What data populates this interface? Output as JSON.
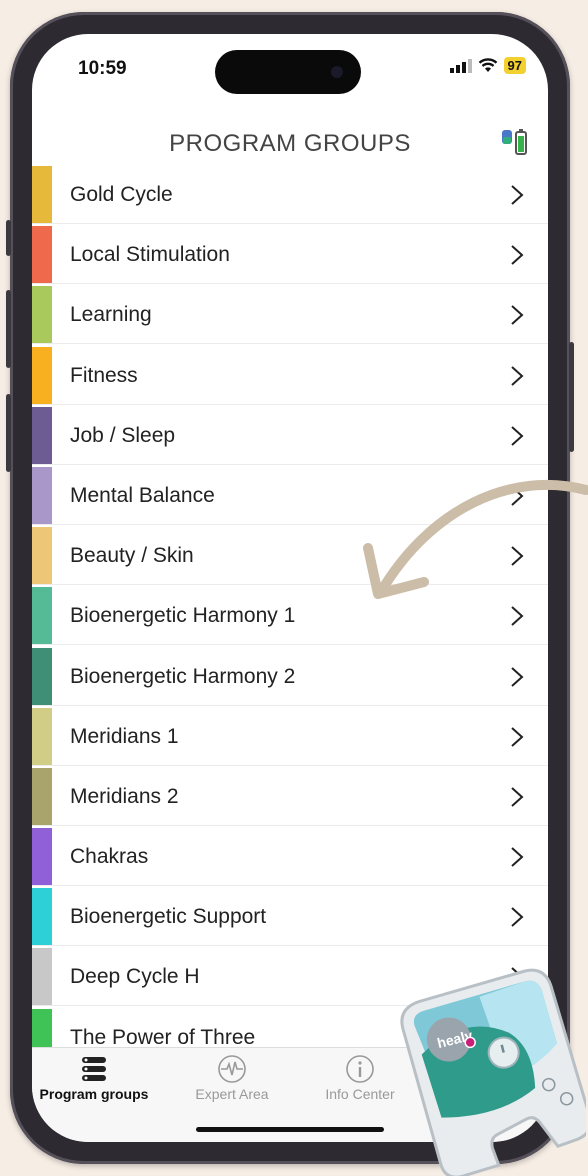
{
  "status_bar": {
    "time": "10:59",
    "battery": "97"
  },
  "header": {
    "title": "PROGRAM GROUPS"
  },
  "groups": [
    {
      "label": "Gold Cycle",
      "color": "#e6b93a"
    },
    {
      "label": "Local Stimulation",
      "color": "#ef6a4c"
    },
    {
      "label": "Learning",
      "color": "#a9c95d"
    },
    {
      "label": "Fitness",
      "color": "#f8b020"
    },
    {
      "label": "Job / Sleep",
      "color": "#6d5b93"
    },
    {
      "label": "Mental Balance",
      "color": "#a897c8"
    },
    {
      "label": "Beauty / Skin",
      "color": "#eec678"
    },
    {
      "label": "Bioenergetic Harmony 1",
      "color": "#55bb97"
    },
    {
      "label": "Bioenergetic Harmony 2",
      "color": "#3e8f75"
    },
    {
      "label": "Meridians 1",
      "color": "#d2cd86"
    },
    {
      "label": "Meridians 2",
      "color": "#a9a46b"
    },
    {
      "label": "Chakras",
      "color": "#9060d8"
    },
    {
      "label": "Bioenergetic Support",
      "color": "#2cd0d6"
    },
    {
      "label": "Deep Cycle H",
      "color": "#c8c8c8"
    },
    {
      "label": "The Power of Three",
      "color": "#3fc256"
    }
  ],
  "tabs": [
    {
      "label": "Program groups",
      "active": true,
      "icon": "list-icon"
    },
    {
      "label": "Expert Area",
      "active": false,
      "icon": "pulse-icon"
    },
    {
      "label": "Info Center",
      "active": false,
      "icon": "info-icon"
    }
  ],
  "overlay": {
    "arrow_color": "#cbbda8",
    "device_logo": "healy"
  }
}
